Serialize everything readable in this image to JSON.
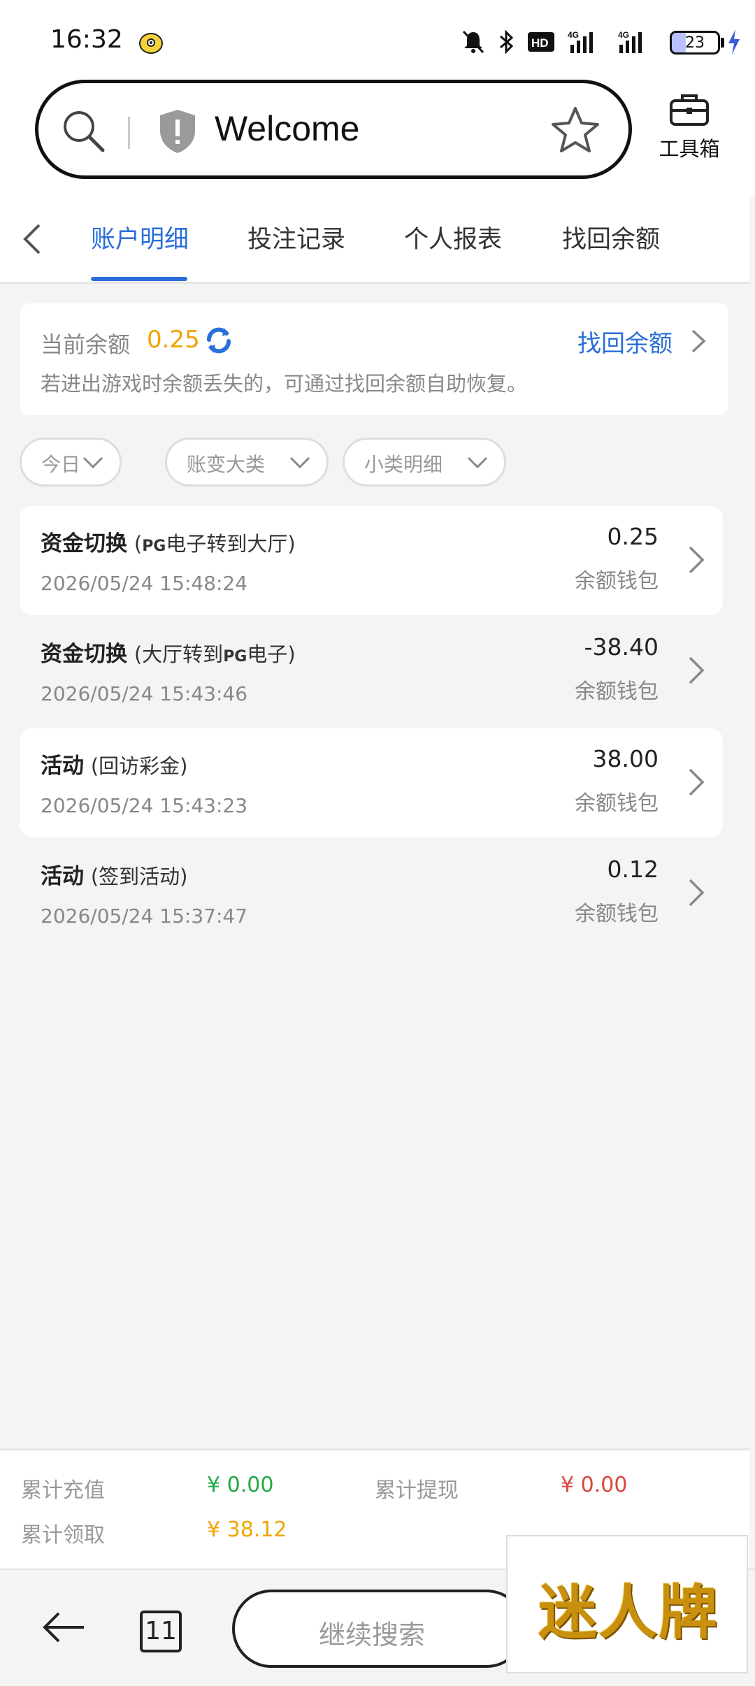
{
  "status_bar": {
    "time": "16:32",
    "battery": "23"
  },
  "browser": {
    "url_text": "Welcome",
    "toolbox_label": "工具箱"
  },
  "tabs": [
    {
      "label": "账户明细",
      "active": true
    },
    {
      "label": "投注记录",
      "active": false
    },
    {
      "label": "个人报表",
      "active": false
    },
    {
      "label": "找回余额",
      "active": false
    }
  ],
  "balance": {
    "label": "当前余额",
    "value": "0.25",
    "link": "找回余额",
    "hint": "若进出游戏时余额丢失的，可通过找回余额自助恢复。"
  },
  "filters": [
    {
      "label": "今日"
    },
    {
      "label": "账变大类"
    },
    {
      "label": "小类明细"
    }
  ],
  "records": [
    {
      "title": "资金切换",
      "detail_prefix": "(",
      "brand": "PG",
      "detail_suffix": "电子转到大厅)",
      "time": "2026/05/24 15:48:24",
      "amount": "0.25",
      "wallet": "余额钱包"
    },
    {
      "title": "资金切换",
      "detail_prefix": "(大厅转到",
      "brand": "PG",
      "detail_suffix": "电子)",
      "time": "2026/05/24 15:43:46",
      "amount": "-38.40",
      "wallet": "余额钱包"
    },
    {
      "title": "活动",
      "detail_prefix": "(回访彩金)",
      "brand": "",
      "detail_suffix": "",
      "time": "2026/05/24 15:43:23",
      "amount": "38.00",
      "wallet": "余额钱包"
    },
    {
      "title": "活动",
      "detail_prefix": "(签到活动)",
      "brand": "",
      "detail_suffix": "",
      "time": "2026/05/24 15:37:47",
      "amount": "0.12",
      "wallet": "余额钱包"
    }
  ],
  "summary": {
    "recharge_label": "累计充值",
    "recharge_value": "¥ 0.00",
    "withdraw_label": "累计提现",
    "withdraw_value": "¥ 0.00",
    "claim_label": "累计领取",
    "claim_value": "¥ 38.12"
  },
  "bottom_nav": {
    "tab_count": "11",
    "search_label": "继续搜索"
  },
  "ad": {
    "text": "迷人牌"
  },
  "colors": {
    "accent": "#2a6fd9",
    "balance": "#f0a400",
    "green": "#22aa44",
    "red": "#d9473b"
  }
}
